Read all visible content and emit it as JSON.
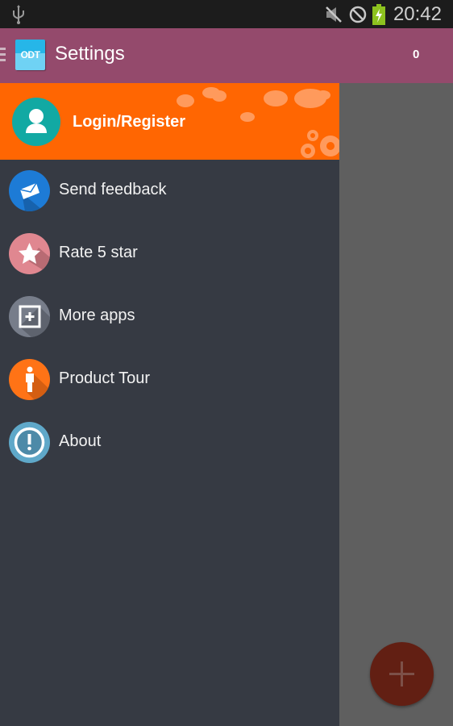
{
  "status_bar": {
    "time": "20:42",
    "icons": [
      "usb-icon",
      "mute-icon",
      "do-not-disturb-icon",
      "battery-charging-icon"
    ],
    "battery_color": "#8dc21f"
  },
  "app_bar": {
    "logo_text": "ODT",
    "title": "Settings",
    "count": "0",
    "color": "#944a6c"
  },
  "drawer": {
    "header": {
      "label": "Login/Register",
      "background": "#ff6602"
    },
    "items": [
      {
        "label": "Send feedback",
        "icon": "envelope-icon",
        "color": "#1d7bd6"
      },
      {
        "label": "Rate 5 star",
        "icon": "star-icon",
        "color": "#e08790"
      },
      {
        "label": "More apps",
        "icon": "plus-square-icon",
        "color": "#777d8a"
      },
      {
        "label": "Product Tour",
        "icon": "person-icon",
        "color": "#ff7316"
      },
      {
        "label": "About",
        "icon": "info-exclamation-icon",
        "color": "#5fa8c9"
      }
    ]
  },
  "fab": {
    "icon": "plus-icon",
    "color": "#621f13"
  }
}
